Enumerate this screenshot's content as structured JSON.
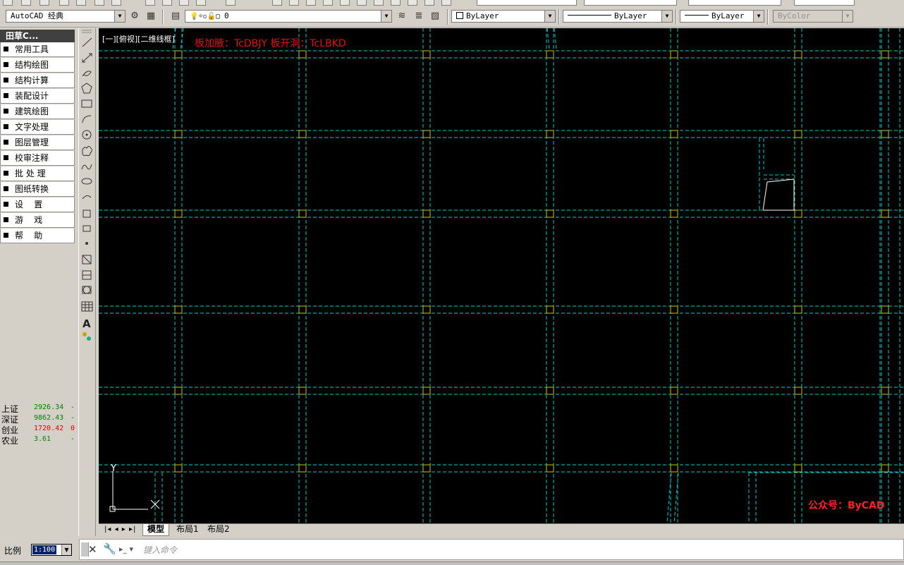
{
  "toolbar": {
    "workspace": "AutoCAD 经典",
    "layer": "0",
    "color": "ByLayer",
    "linetype": "ByLayer",
    "lineweight": "ByLayer",
    "plotstyle": "ByColor"
  },
  "panel": {
    "title": "田草C...",
    "items": [
      "常用工具",
      "结构绘图",
      "结构计算",
      "装配设计",
      "建筑绘图",
      "文字处理",
      "图层管理",
      "校审注释",
      "批 处 理",
      "图纸转换",
      "设    置",
      "游    戏",
      "帮    助"
    ]
  },
  "stocks": [
    {
      "name": "上证",
      "value": "2926.34",
      "change": "-",
      "color": "#008000"
    },
    {
      "name": "深证",
      "value": "9862.43",
      "change": "-",
      "color": "#008000"
    },
    {
      "name": "创业",
      "value": "1720.42",
      "change": "0",
      "color": "#e00000"
    },
    {
      "name": "农业",
      "value": "3.61",
      "change": "-",
      "color": "#008000"
    }
  ],
  "viewport": {
    "label": "[一][俯视][二维线框]",
    "hint": "板加腋：TcDBJY 板开洞：TcLBKD",
    "watermark": "公众号：ByCAD",
    "ucs_y": "Y"
  },
  "tabs": [
    "模型",
    "布局1",
    "布局2"
  ],
  "statusbar": {
    "scale_label": "比例",
    "scale_value": "1:100",
    "command_placeholder": "键入命令"
  },
  "colors": {
    "grid_line": "#00c8c8",
    "column": "#c8c800",
    "hint": "#e01010",
    "watermark": "#ff2020"
  }
}
